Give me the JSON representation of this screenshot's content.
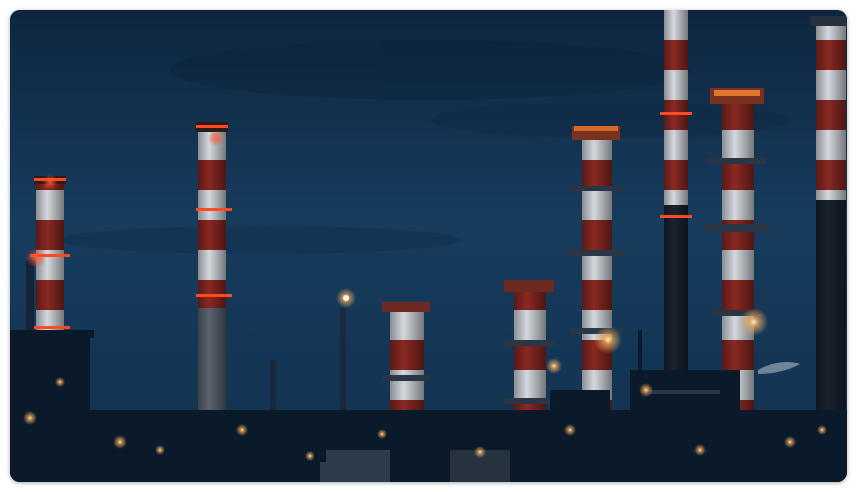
{
  "image": {
    "subject": "industrial-refinery-at-dusk",
    "colors": {
      "sky_top": "#0f2a45",
      "sky_mid": "#163a5a",
      "sky_low": "#123250",
      "stack_red": "#8e2a24",
      "stack_white": "#d9dde3",
      "light_warm": "#ffb25a",
      "light_red": "#ff3a1e",
      "structure_dark": "#0a1826"
    }
  }
}
